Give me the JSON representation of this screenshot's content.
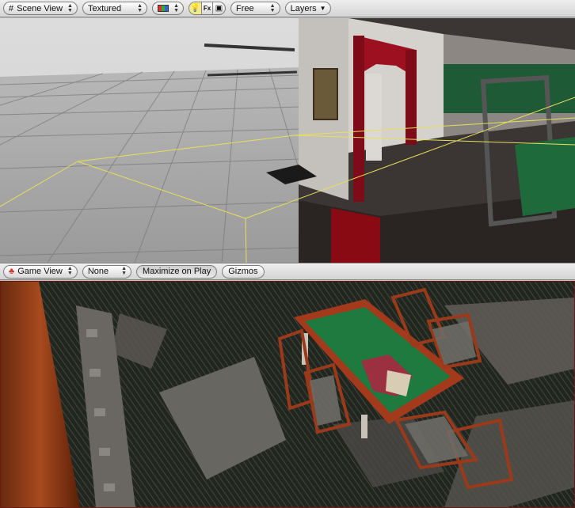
{
  "scene_toolbar": {
    "view_dropdown": "Scene View",
    "render_mode": "Textured",
    "color_mode_icon": "rgb-swatch-icon",
    "toggles": [
      {
        "icon": "lightbulb-icon",
        "active": true
      },
      {
        "icon": "fx-icon",
        "label": "Fx",
        "active": false
      },
      {
        "icon": "cube-icon",
        "active": false
      }
    ],
    "camera_mode": "Free",
    "layers": "Layers"
  },
  "game_toolbar": {
    "view_dropdown": "Game View",
    "aspect": "None",
    "maximize_button": "Maximize on Play",
    "gizmos_button": "Gizmos"
  },
  "colors": {
    "toolbar_bg": "#dcdcdc",
    "grid_floor": "#a2a2a2",
    "frustum_line": "#e6e05a",
    "table_felt": "#1f7a3f",
    "table_wood": "#a33a1c",
    "curtain_red": "#9c1020",
    "game_border": "#6b1b10"
  }
}
